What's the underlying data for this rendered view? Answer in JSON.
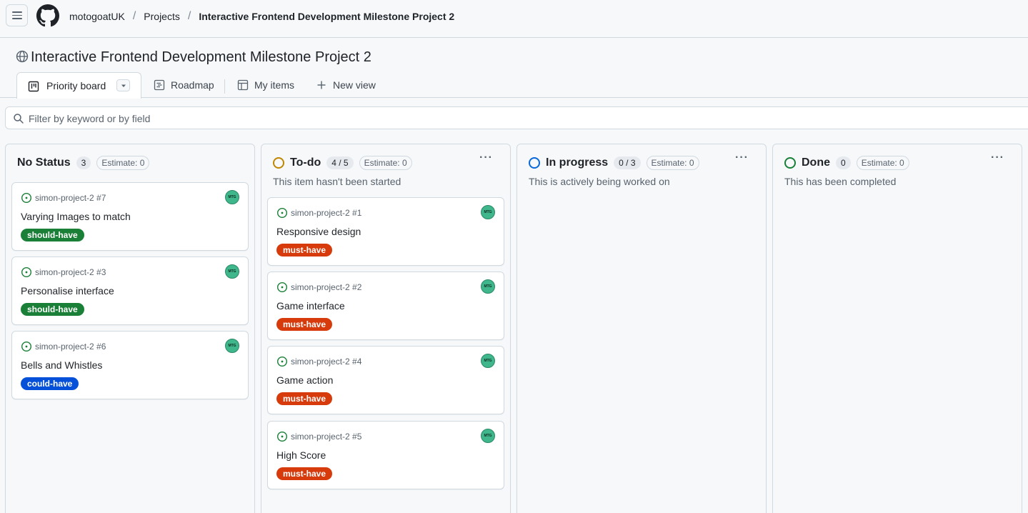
{
  "breadcrumb": {
    "owner": "motogoatUK",
    "projects": "Projects",
    "project": "Interactive Frontend Development Milestone Project 2"
  },
  "project": {
    "title": "Interactive Frontend Development Milestone Project 2"
  },
  "tabs": {
    "priority_board": "Priority board",
    "roadmap": "Roadmap",
    "my_items": "My items",
    "new_view": "New view"
  },
  "filter": {
    "placeholder": "Filter by keyword or by field"
  },
  "colors": {
    "should_have": "#1a7f37",
    "must_have": "#d73a0b",
    "could_have": "#0550d9",
    "todo_ring": "#bf8700",
    "progress_ring": "#0969da",
    "done_ring": "#1a7f37"
  },
  "columns": [
    {
      "name": "No Status",
      "count": "3",
      "estimate": "Estimate: 0",
      "description": "",
      "cards": [
        {
          "repo": "simon-project-2 #7",
          "title": "Varying Images to match",
          "label": "should-have",
          "avatar": "MTG"
        },
        {
          "repo": "simon-project-2 #3",
          "title": "Personalise interface",
          "label": "should-have",
          "avatar": "MTG"
        },
        {
          "repo": "simon-project-2 #6",
          "title": "Bells and Whistles",
          "label": "could-have",
          "avatar": "MTG"
        }
      ]
    },
    {
      "name": "To-do",
      "count": "4 / 5",
      "estimate": "Estimate: 0",
      "description": "This item hasn't been started",
      "cards": [
        {
          "repo": "simon-project-2 #1",
          "title": "Responsive design",
          "label": "must-have",
          "avatar": "MTG"
        },
        {
          "repo": "simon-project-2 #2",
          "title": "Game interface",
          "label": "must-have",
          "avatar": "MTG"
        },
        {
          "repo": "simon-project-2 #4",
          "title": "Game action",
          "label": "must-have",
          "avatar": "MTG"
        },
        {
          "repo": "simon-project-2 #5",
          "title": "High Score",
          "label": "must-have",
          "avatar": "MTG"
        }
      ]
    },
    {
      "name": "In progress",
      "count": "0 / 3",
      "estimate": "Estimate: 0",
      "description": "This is actively being worked on",
      "cards": []
    },
    {
      "name": "Done",
      "count": "0",
      "estimate": "Estimate: 0",
      "description": "This has been completed",
      "cards": []
    }
  ]
}
